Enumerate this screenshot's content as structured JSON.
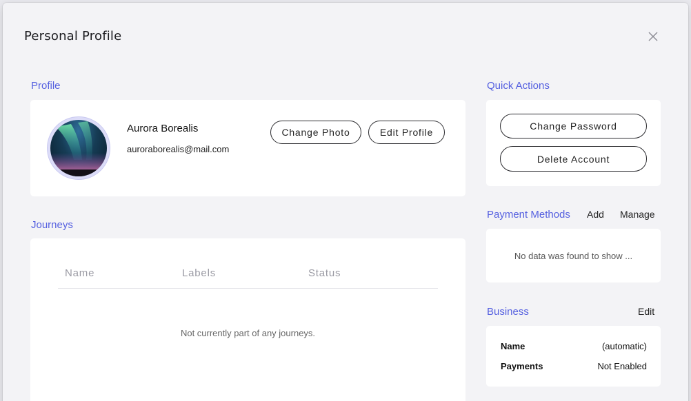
{
  "modal": {
    "title": "Personal Profile",
    "close_icon": "close-icon"
  },
  "profile": {
    "heading": "Profile",
    "name": "Aurora Borealis",
    "email": "auroraborealis@mail.com",
    "change_photo_label": "Change Photo",
    "edit_profile_label": "Edit Profile"
  },
  "journeys": {
    "heading": "Journeys",
    "columns": [
      "Name",
      "Labels",
      "Status"
    ],
    "empty_text": "Not currently part of any journeys."
  },
  "quick_actions": {
    "heading": "Quick Actions",
    "change_password_label": "Change Password",
    "delete_account_label": "Delete Account"
  },
  "payment_methods": {
    "heading": "Payment Methods",
    "add_label": "Add",
    "manage_label": "Manage",
    "empty_text": "No data was found to show ..."
  },
  "business": {
    "heading": "Business",
    "edit_label": "Edit",
    "rows": [
      {
        "label": "Name",
        "value": "(automatic)"
      },
      {
        "label": "Payments",
        "value": "Not Enabled"
      }
    ]
  },
  "colors": {
    "accent": "#5560e0",
    "card_bg": "#ffffff",
    "modal_bg": "#f3f3f6"
  }
}
